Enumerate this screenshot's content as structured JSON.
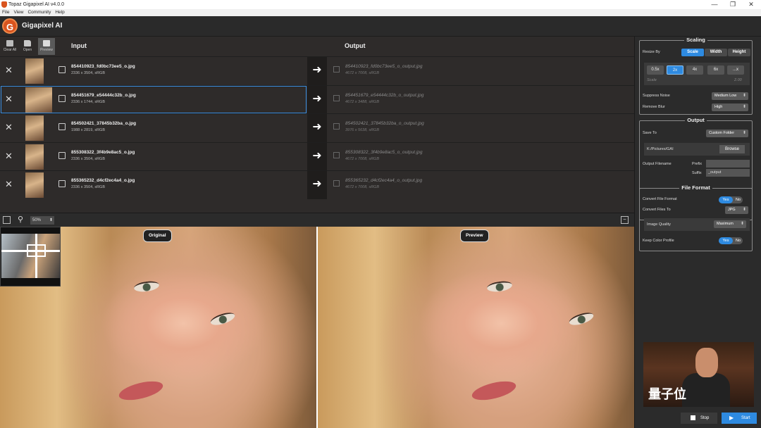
{
  "window": {
    "title": "Topaz Gigapixel AI v4.0.0",
    "minimize": "—",
    "maximize": "❐",
    "close": "✕"
  },
  "menu": [
    "File",
    "View",
    "Community",
    "Help"
  ],
  "header": {
    "logo_letter": "G",
    "app_name": "Gigapixel AI"
  },
  "toolbar": {
    "clear_all": "Clear All",
    "open": "Open",
    "preview": "Preview"
  },
  "columns": {
    "input": "Input",
    "output": "Output"
  },
  "files": [
    {
      "name": "854410923_fd0bc73ee5_o.jpg",
      "meta": "2336 x 3504, sRGB",
      "out_name": "854410923_fd0bc73ee5_o_output.jpg",
      "out_meta": "4672 x 7008, sRGB",
      "selected": false
    },
    {
      "name": "854451679_e54444c32b_o.jpg",
      "meta": "2336 x 1744, sRGB",
      "out_name": "854451679_e54444c32b_o_output.jpg",
      "out_meta": "4672 x 3488, sRGB",
      "selected": true
    },
    {
      "name": "854502421_37845b32ba_o.jpg",
      "meta": "1988 x 2819, sRGB",
      "out_name": "854502421_37845b32ba_o_output.jpg",
      "out_meta": "3976 x 5638, sRGB",
      "selected": false
    },
    {
      "name": "855308322_3f4b9e8ac5_o.jpg",
      "meta": "2336 x 3504, sRGB",
      "out_name": "855308322_3f4b9e8ac5_o_output.jpg",
      "out_meta": "4672 x 7008, sRGB",
      "selected": false
    },
    {
      "name": "855365232_d4cf2ec4a4_o.jpg",
      "meta": "2336 x 3504, sRGB",
      "out_name": "855365232_d4cf2ec4a4_o_output.jpg",
      "out_meta": "4672 x 7008, sRGB",
      "selected": false
    }
  ],
  "viewbar": {
    "zoom": "50%"
  },
  "panes": {
    "original_label": "Original",
    "preview_label": "Preview"
  },
  "scaling": {
    "title": "Scaling",
    "resize_by_label": "Resize By",
    "resize_options": [
      "Scale",
      "Width",
      "Height"
    ],
    "resize_selected": "Scale",
    "scale_presets": [
      "0.5x",
      "2x",
      "4x",
      "6x",
      "...x"
    ],
    "scale_selected": "2x",
    "scale_label": "Scale",
    "scale_value": "2.00",
    "suppress_noise_label": "Suppress Noise",
    "suppress_noise_value": "Medium Low",
    "remove_blur_label": "Remove Blur",
    "remove_blur_value": "High"
  },
  "output": {
    "title": "Output",
    "save_to_label": "Save To",
    "save_to_value": "Custom Folder",
    "folder_path": "K:/Pictures/GAI",
    "browse_label": "Browse",
    "filename_label": "Output Filename",
    "prefix_label": "Prefix",
    "prefix_value": "",
    "suffix_label": "Suffix",
    "suffix_value": "_output"
  },
  "file_format": {
    "title": "File Format",
    "convert_label": "Convert File Format",
    "convert_to_label": "Convert Files To",
    "convert_to_value": "JPG",
    "quality_label": "Image Quality",
    "quality_value": "Maximum",
    "keep_profile_label": "Keep Color Profile",
    "yes": "Yes",
    "no": "No"
  },
  "watermark": "量子位",
  "actions": {
    "stop": "Stop",
    "start": "Start"
  },
  "colors": {
    "accent": "#2e8ae0",
    "brand": "#d9541e",
    "panel": "#2b2b2b"
  }
}
